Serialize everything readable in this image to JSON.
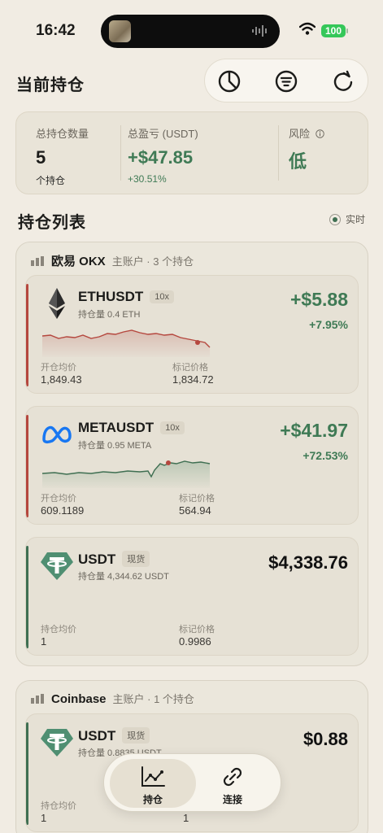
{
  "status_bar": {
    "time": "16:42",
    "battery": "100"
  },
  "header": {
    "title": "当前持仓"
  },
  "toolbar": {
    "icons": [
      "pie-chart-icon",
      "filter-icon",
      "refresh-icon"
    ]
  },
  "summary": {
    "count_label": "总持仓数量",
    "count_value": "5",
    "count_unit": "个持仓",
    "pnl_label": "总盈亏 (USDT)",
    "pnl_value": "+$47.85",
    "pnl_pct": "+30.51%",
    "risk_label": "风险",
    "risk_value": "低"
  },
  "list": {
    "title": "持仓列表",
    "live_label": "实时"
  },
  "groups": [
    {
      "exchange": "欧易 OKX",
      "account": "主账户 · 3 个持仓",
      "positions": [
        {
          "symbol": "ETHUSDT",
          "tag": "10x",
          "holding": "持仓量  0.4 ETH",
          "pnl": "+$5.88",
          "pnl_pct": "+7.95%",
          "entry_label": "开仓均价",
          "entry_value": "1,849.43",
          "mark_label": "标记价格",
          "mark_value": "1,834.72"
        },
        {
          "symbol": "METAUSDT",
          "tag": "10x",
          "holding": "持仓量  0.95 META",
          "pnl": "+$41.97",
          "pnl_pct": "+72.53%",
          "entry_label": "开仓均价",
          "entry_value": "609.1189",
          "mark_label": "标记价格",
          "mark_value": "564.94"
        },
        {
          "symbol": "USDT",
          "tag": "现货",
          "holding": "持仓量  4,344.62 USDT",
          "value": "$4,338.76",
          "entry_label": "持仓均价",
          "entry_value": "1",
          "mark_label": "标记价格",
          "mark_value": "0.9986"
        }
      ]
    },
    {
      "exchange": "Coinbase",
      "account": "主账户 · 1 个持仓",
      "positions": [
        {
          "symbol": "USDT",
          "tag": "现货",
          "holding": "持仓量  0.8835 USDT",
          "value": "$0.88",
          "entry_label": "持仓均价",
          "entry_value": "1",
          "mark_value": "1"
        }
      ]
    }
  ],
  "bottom_nav": {
    "holdings_label": "持仓",
    "connect_label": "连接"
  },
  "colors": {
    "profit": "#3f7a55",
    "loss_accent": "#b5473e",
    "spot_accent": "#3f6f52"
  }
}
